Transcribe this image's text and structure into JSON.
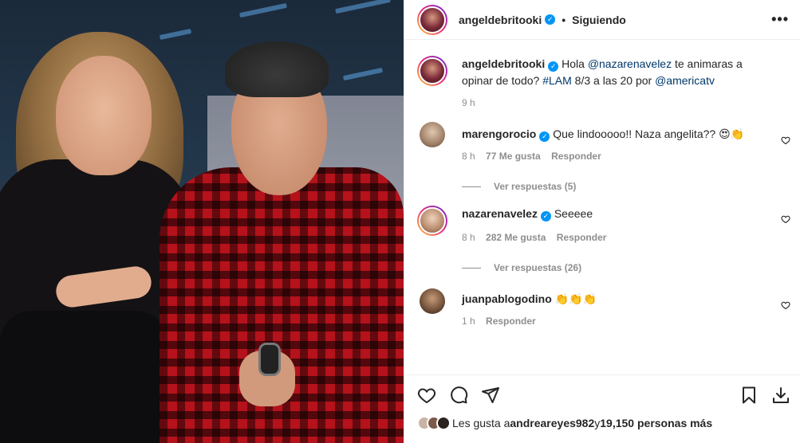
{
  "post": {
    "username": "angeldebritooki",
    "follow_status": "Siguiendo",
    "more_label": "•••"
  },
  "caption": {
    "username": "angeldebritooki",
    "text_1": "Hola ",
    "mention": "@nazarenavelez",
    "text_2": " te animaras a opinar de todo? ",
    "hashtag": "#LAM",
    "text_3": " 8/3 a las 20 por ",
    "mention_2": "@americatv",
    "time": "9 h"
  },
  "comments": [
    {
      "username": "marengorocio",
      "text": "Que lindooooo!! Naza angelita?? 😍👏",
      "time": "8 h",
      "likes": "77 Me gusta",
      "reply": "Responder",
      "view_replies": "Ver respuestas (5)"
    },
    {
      "username": "nazarenavelez",
      "text": "Seeeee",
      "time": "8 h",
      "likes": "282 Me gusta",
      "reply": "Responder",
      "view_replies": "Ver respuestas (26)"
    },
    {
      "username": "juanpablogodino",
      "text": "👏👏👏",
      "time": "1 h",
      "reply": "Responder"
    }
  ],
  "likes_line": {
    "prefix": "Les gusta a ",
    "user": "andreareyes982",
    "middle": " y ",
    "others": "19,150 personas más"
  },
  "colors": {
    "verified": "#0095f6",
    "link": "#00376b",
    "muted": "#8e8e8e"
  }
}
